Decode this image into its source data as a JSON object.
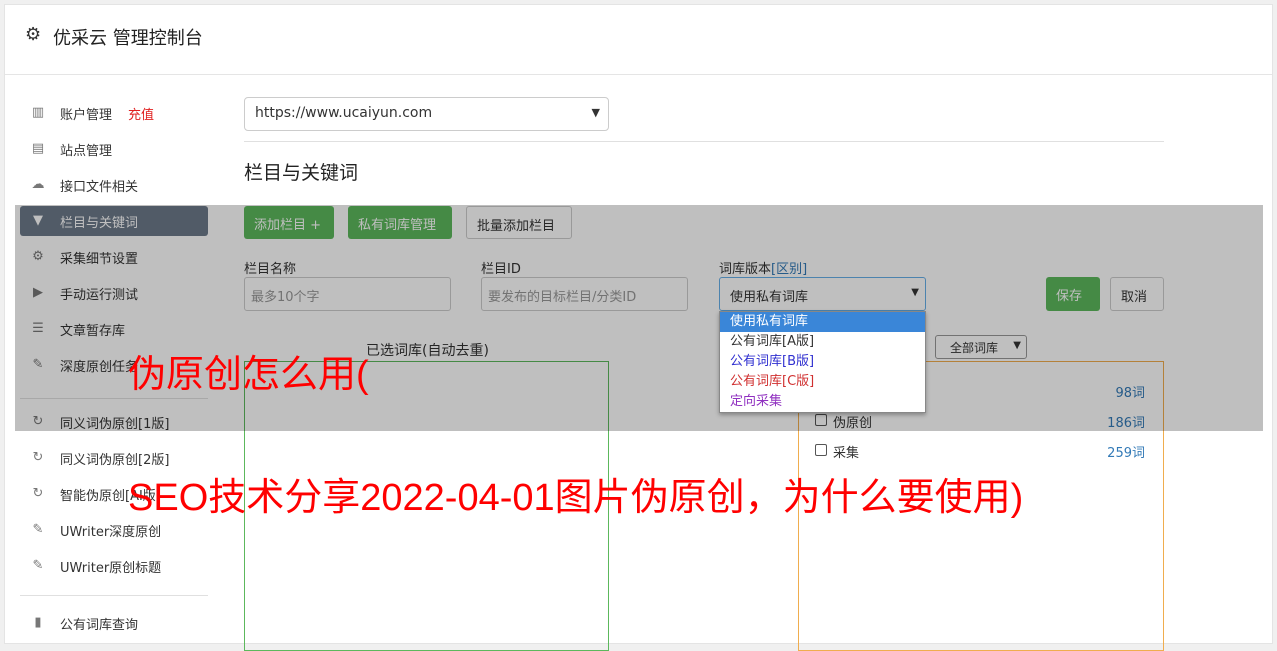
{
  "header": {
    "title": "优采云 管理控制台",
    "icon": "gear-icon"
  },
  "sidebar": {
    "items": [
      {
        "label": "账户管理",
        "badge": "充值",
        "icon": "bar-chart-icon",
        "glyph": "▥"
      },
      {
        "label": "站点管理",
        "icon": "server-icon",
        "glyph": "▤"
      },
      {
        "label": "接口文件相关",
        "icon": "cloud-upload-icon",
        "glyph": "☁"
      },
      {
        "label": "栏目与关键词",
        "icon": "filter-icon",
        "glyph": "▼"
      },
      {
        "label": "采集细节设置",
        "icon": "cogs-icon",
        "glyph": "⚙"
      },
      {
        "label": "手动运行测试",
        "icon": "play-circle-icon",
        "glyph": "▶"
      },
      {
        "label": "文章暂存库",
        "icon": "database-icon",
        "glyph": "☰"
      },
      {
        "label": "深度原创任务",
        "icon": "edit-icon",
        "glyph": "✎"
      },
      {
        "label": "同义词伪原创[1版]",
        "icon": "refresh-icon",
        "glyph": "↻"
      },
      {
        "label": "同义词伪原创[2版]",
        "icon": "refresh-icon",
        "glyph": "↻"
      },
      {
        "label": "智能伪原创[AI版]",
        "icon": "refresh-icon",
        "glyph": "↻"
      },
      {
        "label": "UWriter深度原创",
        "icon": "edit-icon",
        "glyph": "✎"
      },
      {
        "label": "UWriter原创标题",
        "icon": "edit-icon",
        "glyph": "✎"
      },
      {
        "label": "公有词库查询",
        "icon": "book-icon",
        "glyph": "▮"
      }
    ],
    "active_index": 3
  },
  "site_select": {
    "value": "https://www.ucaiyun.com"
  },
  "section_title": "栏目与关键词",
  "toolbar": {
    "add_column": "添加栏目 +",
    "private_lib": "私有词库管理",
    "bulk_add": "批量添加栏目"
  },
  "form": {
    "column_name_label": "栏目名称",
    "column_name_placeholder": "最多10个字",
    "column_id_label": "栏目ID",
    "column_id_placeholder": "要发布的目标栏目/分类ID",
    "lib_version_label": "词库版本",
    "lib_version_link": "[区别]",
    "lib_version_value": "使用私有词库",
    "save": "保存",
    "cancel": "取消"
  },
  "dropdown": {
    "options": [
      {
        "label": "使用私有词库",
        "color": "#ffffff",
        "selected": true
      },
      {
        "label": "公有词库[A版]",
        "color": "#333333"
      },
      {
        "label": "公有词库[B版]",
        "color": "#3030d0"
      },
      {
        "label": "公有词库[C版]",
        "color": "#d03030"
      },
      {
        "label": "定向采集",
        "color": "#9030c0"
      }
    ]
  },
  "selected_lib": {
    "label": "已选词库(自动去重)"
  },
  "lib_filter": {
    "value": "全部词库"
  },
  "libraries": [
    {
      "name": "",
      "count": "98词"
    },
    {
      "name": "伪原创",
      "count": "186词"
    },
    {
      "name": "采集",
      "count": "259词"
    }
  ],
  "watermark": {
    "line1": "伪原创怎么用(",
    "line2": "SEO技术分享2022-04-01图片伪原创，为什么要使用)"
  },
  "colors": {
    "accent_green": "#5cb85c",
    "active_sidebar": "#6c7a8a",
    "watermark": "#ff0000"
  }
}
